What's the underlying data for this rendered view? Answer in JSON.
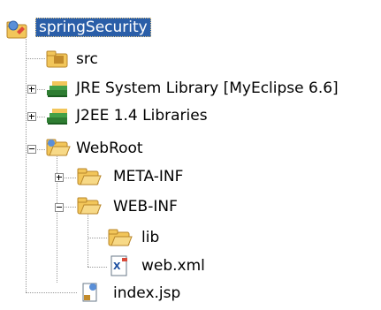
{
  "tree": {
    "project": {
      "label": "springSecurity",
      "icon": "java-project-icon",
      "selected": true
    },
    "children": [
      {
        "label": "src",
        "icon": "source-folder-icon"
      },
      {
        "label": "JRE System Library [MyEclipse 6.6]",
        "icon": "library-icon",
        "expander": "plus"
      },
      {
        "label": "J2EE 1.4 Libraries",
        "icon": "library-icon",
        "expander": "plus"
      },
      {
        "label": "WebRoot",
        "icon": "web-folder-icon",
        "expander": "minus"
      },
      {
        "label": "META-INF",
        "icon": "folder-icon",
        "expander": "plus"
      },
      {
        "label": "WEB-INF",
        "icon": "folder-icon",
        "expander": "minus"
      },
      {
        "label": "lib",
        "icon": "folder-icon"
      },
      {
        "label": "web.xml",
        "icon": "xml-file-icon"
      },
      {
        "label": "index.jsp",
        "icon": "jsp-file-icon"
      }
    ]
  },
  "colors": {
    "selection": "#2a5ea8",
    "folder": "#f2c65a",
    "library": "#2e7d32"
  }
}
